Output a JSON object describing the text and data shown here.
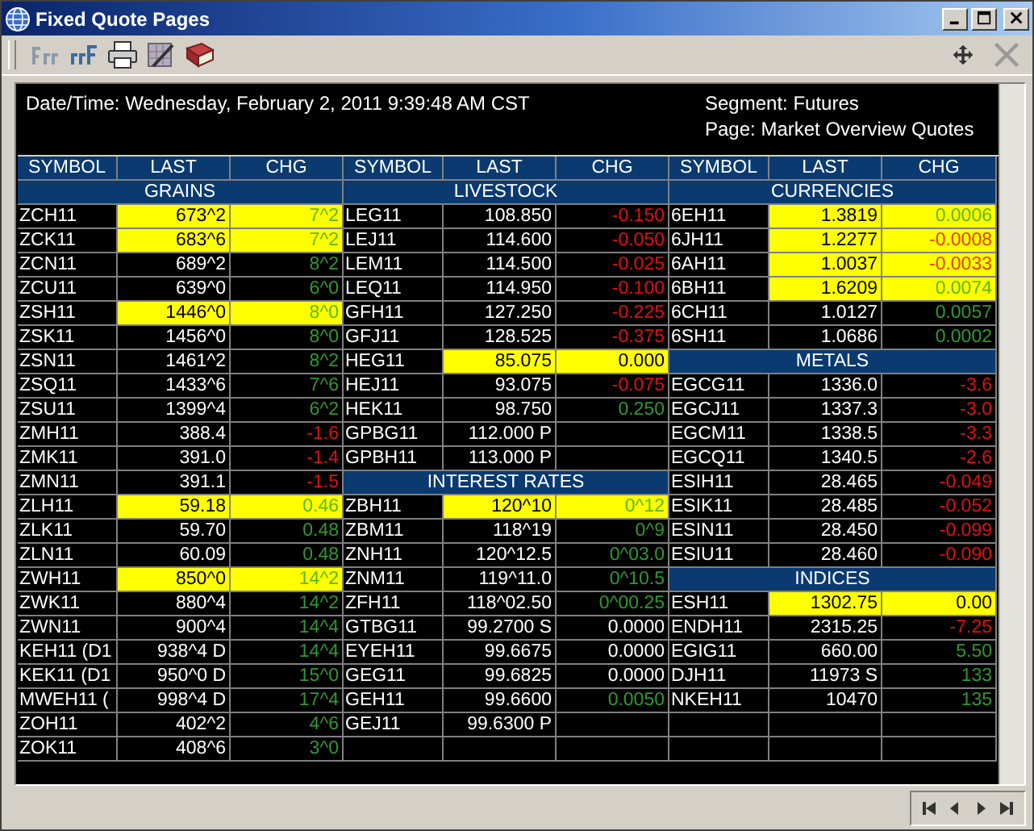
{
  "window": {
    "title": "Fixed Quote Pages"
  },
  "header": {
    "datetime": "Date/Time: Wednesday, February 2, 2011 9:39:48 AM CST",
    "segment": "Segment: Futures",
    "page": "Page: Market Overview Quotes"
  },
  "panels": [
    {
      "columns": [
        "SYMBOL",
        "LAST",
        "CHG"
      ],
      "rows": [
        {
          "kind": "section",
          "label": "GRAINS"
        },
        {
          "kind": "quote",
          "symbol": "ZCH11",
          "last": "673^2",
          "chg": "7^2",
          "gain": true,
          "loss": false,
          "highlighted": true
        },
        {
          "kind": "quote",
          "symbol": "ZCK11",
          "last": "683^6",
          "chg": "7^2",
          "gain": true,
          "loss": false,
          "highlighted": true
        },
        {
          "kind": "quote",
          "symbol": "ZCN11",
          "last": "689^2",
          "chg": "8^2",
          "gain": true,
          "loss": false,
          "highlighted": false
        },
        {
          "kind": "quote",
          "symbol": "ZCU11",
          "last": "639^0",
          "chg": "6^0",
          "gain": true,
          "loss": false,
          "highlighted": false
        },
        {
          "kind": "quote",
          "symbol": "ZSH11",
          "last": "1446^0",
          "chg": "8^0",
          "gain": true,
          "loss": false,
          "highlighted": true
        },
        {
          "kind": "quote",
          "symbol": "ZSK11",
          "last": "1456^0",
          "chg": "8^0",
          "gain": true,
          "loss": false,
          "highlighted": false
        },
        {
          "kind": "quote",
          "symbol": "ZSN11",
          "last": "1461^2",
          "chg": "8^2",
          "gain": true,
          "loss": false,
          "highlighted": false
        },
        {
          "kind": "quote",
          "symbol": "ZSQ11",
          "last": "1433^6",
          "chg": "7^6",
          "gain": true,
          "loss": false,
          "highlighted": false
        },
        {
          "kind": "quote",
          "symbol": "ZSU11",
          "last": "1399^4",
          "chg": "6^2",
          "gain": true,
          "loss": false,
          "highlighted": false
        },
        {
          "kind": "quote",
          "symbol": "ZMH11",
          "last": "388.4",
          "chg": "-1.6",
          "gain": false,
          "loss": true,
          "highlighted": false
        },
        {
          "kind": "quote",
          "symbol": "ZMK11",
          "last": "391.0",
          "chg": "-1.4",
          "gain": false,
          "loss": true,
          "highlighted": false
        },
        {
          "kind": "quote",
          "symbol": "ZMN11",
          "last": "391.1",
          "chg": "-1.5",
          "gain": false,
          "loss": true,
          "highlighted": false
        },
        {
          "kind": "quote",
          "symbol": "ZLH11",
          "last": "59.18",
          "chg": "0.46",
          "gain": true,
          "loss": false,
          "highlighted": true
        },
        {
          "kind": "quote",
          "symbol": "ZLK11",
          "last": "59.70",
          "chg": "0.48",
          "gain": true,
          "loss": false,
          "highlighted": false
        },
        {
          "kind": "quote",
          "symbol": "ZLN11",
          "last": "60.09",
          "chg": "0.48",
          "gain": true,
          "loss": false,
          "highlighted": false
        },
        {
          "kind": "quote",
          "symbol": "ZWH11",
          "last": "850^0",
          "chg": "14^2",
          "gain": true,
          "loss": false,
          "highlighted": true
        },
        {
          "kind": "quote",
          "symbol": "ZWK11",
          "last": "880^4",
          "chg": "14^2",
          "gain": true,
          "loss": false,
          "highlighted": false
        },
        {
          "kind": "quote",
          "symbol": "ZWN11",
          "last": "900^4",
          "chg": "14^4",
          "gain": true,
          "loss": false,
          "highlighted": false
        },
        {
          "kind": "quote",
          "symbol": "KEH11 (D1",
          "last": "938^4 D",
          "chg": "14^4",
          "gain": true,
          "loss": false,
          "highlighted": false
        },
        {
          "kind": "quote",
          "symbol": "KEK11 (D1",
          "last": "950^0 D",
          "chg": "15^0",
          "gain": true,
          "loss": false,
          "highlighted": false
        },
        {
          "kind": "quote",
          "symbol": "MWEH11 (",
          "last": "998^4 D",
          "chg": "17^4",
          "gain": true,
          "loss": false,
          "highlighted": false
        },
        {
          "kind": "quote",
          "symbol": "ZOH11",
          "last": "402^2",
          "chg": "4^6",
          "gain": true,
          "loss": false,
          "highlighted": false
        },
        {
          "kind": "quote",
          "symbol": "ZOK11",
          "last": "408^6",
          "chg": "3^0",
          "gain": true,
          "loss": false,
          "highlighted": false
        }
      ]
    },
    {
      "columns": [
        "SYMBOL",
        "LAST",
        "CHG"
      ],
      "rows": [
        {
          "kind": "section",
          "label": "LIVESTOCK"
        },
        {
          "kind": "quote",
          "symbol": "LEG11",
          "last": "108.850",
          "chg": "-0.150",
          "gain": false,
          "loss": true,
          "highlighted": false
        },
        {
          "kind": "quote",
          "symbol": "LEJ11",
          "last": "114.600",
          "chg": "-0.050",
          "gain": false,
          "loss": true,
          "highlighted": false
        },
        {
          "kind": "quote",
          "symbol": "LEM11",
          "last": "114.500",
          "chg": "-0.025",
          "gain": false,
          "loss": true,
          "highlighted": false
        },
        {
          "kind": "quote",
          "symbol": "LEQ11",
          "last": "114.950",
          "chg": "-0.100",
          "gain": false,
          "loss": true,
          "highlighted": false
        },
        {
          "kind": "quote",
          "symbol": "GFH11",
          "last": "127.250",
          "chg": "-0.225",
          "gain": false,
          "loss": true,
          "highlighted": false
        },
        {
          "kind": "quote",
          "symbol": "GFJ11",
          "last": "128.525",
          "chg": "-0.375",
          "gain": false,
          "loss": true,
          "highlighted": false
        },
        {
          "kind": "quote",
          "symbol": "HEG11",
          "last": "85.075",
          "chg": "0.000",
          "gain": false,
          "loss": false,
          "highlighted": true
        },
        {
          "kind": "quote",
          "symbol": "HEJ11",
          "last": "93.075",
          "chg": "-0.075",
          "gain": false,
          "loss": true,
          "highlighted": false
        },
        {
          "kind": "quote",
          "symbol": "HEK11",
          "last": "98.750",
          "chg": "0.250",
          "gain": true,
          "loss": false,
          "highlighted": false
        },
        {
          "kind": "quote",
          "symbol": "GPBG11",
          "last": "112.000 P",
          "highlighted": false
        },
        {
          "kind": "quote",
          "symbol": "GPBH11",
          "last": "113.000 P",
          "highlighted": false
        },
        {
          "kind": "section",
          "label": "INTEREST RATES"
        },
        {
          "kind": "quote",
          "symbol": "ZBH11",
          "last": "120^10",
          "chg": "0^12",
          "gain": true,
          "loss": false,
          "highlighted": true
        },
        {
          "kind": "quote",
          "symbol": "ZBM11",
          "last": "118^19",
          "chg": "0^9",
          "gain": true,
          "loss": false,
          "highlighted": false
        },
        {
          "kind": "quote",
          "symbol": "ZNH11",
          "last": "120^12.5",
          "chg": "0^03.0",
          "gain": true,
          "loss": false,
          "highlighted": false
        },
        {
          "kind": "quote",
          "symbol": "ZNM11",
          "last": "119^11.0",
          "chg": "0^10.5",
          "gain": true,
          "loss": false,
          "highlighted": false
        },
        {
          "kind": "quote",
          "symbol": "ZFH11",
          "last": "118^02.50",
          "chg": "0^00.25",
          "gain": true,
          "loss": false,
          "highlighted": false
        },
        {
          "kind": "quote",
          "symbol": "GTBG11",
          "last": "99.2700 S",
          "chg": "0.0000",
          "gain": false,
          "loss": false,
          "highlighted": false
        },
        {
          "kind": "quote",
          "symbol": "EYEH11",
          "last": "99.6675",
          "chg": "0.0000",
          "gain": false,
          "loss": false,
          "highlighted": false
        },
        {
          "kind": "quote",
          "symbol": "GEG11",
          "last": "99.6825",
          "chg": "0.0000",
          "gain": false,
          "loss": false,
          "highlighted": false
        },
        {
          "kind": "quote",
          "symbol": "GEH11",
          "last": "99.6600",
          "chg": "0.0050",
          "gain": true,
          "loss": false,
          "highlighted": false
        },
        {
          "kind": "quote",
          "symbol": "GEJ11",
          "last": "99.6300 P",
          "highlighted": false
        },
        {
          "kind": "blank"
        }
      ]
    },
    {
      "columns": [
        "SYMBOL",
        "LAST",
        "CHG"
      ],
      "rows": [
        {
          "kind": "section",
          "label": "CURRENCIES"
        },
        {
          "kind": "quote",
          "symbol": "6EH11",
          "last": "1.3819",
          "chg": "0.0006",
          "gain": true,
          "loss": false,
          "highlighted": true
        },
        {
          "kind": "quote",
          "symbol": "6JH11",
          "last": "1.2277",
          "chg": "-0.0008",
          "gain": false,
          "loss": true,
          "highlighted": true
        },
        {
          "kind": "quote",
          "symbol": "6AH11",
          "last": "1.0037",
          "chg": "-0.0033",
          "gain": false,
          "loss": true,
          "highlighted": true
        },
        {
          "kind": "quote",
          "symbol": "6BH11",
          "last": "1.6209",
          "chg": "0.0074",
          "gain": true,
          "loss": false,
          "highlighted": true
        },
        {
          "kind": "quote",
          "symbol": "6CH11",
          "last": "1.0127",
          "chg": "0.0057",
          "gain": true,
          "loss": false,
          "highlighted": false
        },
        {
          "kind": "quote",
          "symbol": "6SH11",
          "last": "1.0686",
          "chg": "0.0002",
          "gain": true,
          "loss": false,
          "highlighted": false
        },
        {
          "kind": "section",
          "label": "METALS"
        },
        {
          "kind": "quote",
          "symbol": "EGCG11",
          "last": "1336.0",
          "chg": "-3.6",
          "gain": false,
          "loss": true,
          "highlighted": false
        },
        {
          "kind": "quote",
          "symbol": "EGCJ11",
          "last": "1337.3",
          "chg": "-3.0",
          "gain": false,
          "loss": true,
          "highlighted": false
        },
        {
          "kind": "quote",
          "symbol": "EGCM11",
          "last": "1338.5",
          "chg": "-3.3",
          "gain": false,
          "loss": true,
          "highlighted": false
        },
        {
          "kind": "quote",
          "symbol": "EGCQ11",
          "last": "1340.5",
          "chg": "-2.6",
          "gain": false,
          "loss": true,
          "highlighted": false
        },
        {
          "kind": "quote",
          "symbol": "ESIH11",
          "last": "28.465",
          "chg": "-0.049",
          "gain": false,
          "loss": true,
          "highlighted": false
        },
        {
          "kind": "quote",
          "symbol": "ESIK11",
          "last": "28.485",
          "chg": "-0.052",
          "gain": false,
          "loss": true,
          "highlighted": false
        },
        {
          "kind": "quote",
          "symbol": "ESIN11",
          "last": "28.450",
          "chg": "-0.099",
          "gain": false,
          "loss": true,
          "highlighted": false
        },
        {
          "kind": "quote",
          "symbol": "ESIU11",
          "last": "28.460",
          "chg": "-0.090",
          "gain": false,
          "loss": true,
          "highlighted": false
        },
        {
          "kind": "section",
          "label": "INDICES"
        },
        {
          "kind": "quote",
          "symbol": "ESH11",
          "last": "1302.75",
          "chg": "0.00",
          "gain": false,
          "loss": false,
          "highlighted": true
        },
        {
          "kind": "quote",
          "symbol": "ENDH11",
          "last": "2315.25",
          "chg": "-7.25",
          "gain": false,
          "loss": true,
          "highlighted": false
        },
        {
          "kind": "quote",
          "symbol": "EGIG11",
          "last": "660.00",
          "chg": "5.50",
          "gain": true,
          "loss": false,
          "highlighted": false
        },
        {
          "kind": "quote",
          "symbol": "DJH11",
          "last": "11973 S",
          "chg": "133",
          "gain": true,
          "loss": false,
          "highlighted": false
        },
        {
          "kind": "quote",
          "symbol": "NKEH11",
          "last": "10470",
          "chg": "135",
          "gain": true,
          "loss": false,
          "highlighted": false
        },
        {
          "kind": "blank"
        },
        {
          "kind": "blank"
        }
      ]
    }
  ]
}
